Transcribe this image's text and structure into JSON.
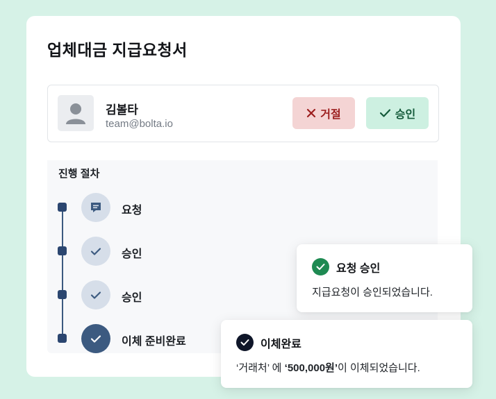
{
  "page_title": "업체대금 지급요청서",
  "user": {
    "name": "김볼타",
    "email": "team@bolta.io",
    "avatar_icon": "person-icon"
  },
  "actions": {
    "reject_label": "거절",
    "approve_label": "승인",
    "reject_color": "#9c1e1e",
    "approve_color": "#145a3a"
  },
  "process": {
    "title": "진행 절차",
    "steps": [
      {
        "label": "요청",
        "icon": "message-icon",
        "status": "pending"
      },
      {
        "label": "승인",
        "icon": "check-icon",
        "status": "pending"
      },
      {
        "label": "승인",
        "icon": "check-icon",
        "status": "pending"
      },
      {
        "label": "이체 준비완료",
        "icon": "check-icon",
        "status": "done"
      }
    ]
  },
  "toasts": [
    {
      "title": "요청 승인",
      "message": "지급요청이 승인되었습니다.",
      "icon_color": "#1e8a52"
    },
    {
      "title": "이체완료",
      "message_parts": [
        "‘거래처’ 에 ",
        "‘500,000원’",
        "이 이체되었습니다."
      ],
      "icon_color": "#0f1629"
    }
  ],
  "colors": {
    "background": "#d6f2e7",
    "accent_dark": "#3c5a80"
  }
}
